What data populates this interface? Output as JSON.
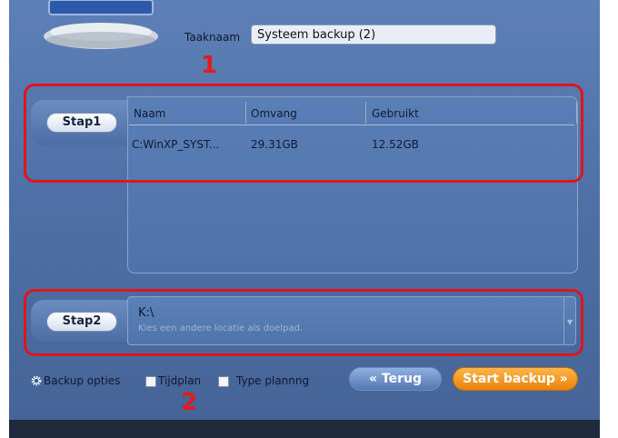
{
  "task": {
    "label": "Taaknaam",
    "value": "Systeem backup (2)"
  },
  "annotations": {
    "one": "1",
    "two": "2"
  },
  "step1": {
    "button_label": "Stap1",
    "columns": [
      "Naam",
      "Omvang",
      "Gebruikt"
    ],
    "rows": [
      {
        "naam": "C:WinXP_SYST...",
        "omvang": "29.31GB",
        "gebruikt": "12.52GB"
      }
    ]
  },
  "step2": {
    "button_label": "Stap2",
    "path": "K:\\",
    "hint": "Kies een andere locatie als doelpad."
  },
  "options": {
    "backup_options": "Backup opties",
    "tijdplan": "Tijdplan",
    "type_planning": "Type plannng"
  },
  "buttons": {
    "back": "« Terug",
    "start": "Start backup »"
  },
  "colors": {
    "annotation_red": "#e0151b",
    "start_orange": "#f09a1f",
    "panel_blue": "#5075ac"
  }
}
